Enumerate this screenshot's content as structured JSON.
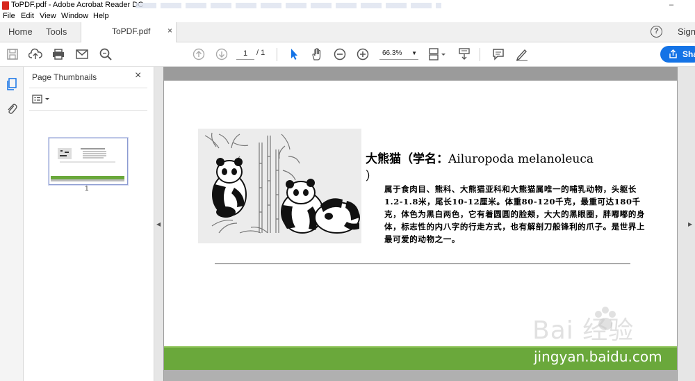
{
  "window": {
    "title": "ToPDF.pdf - Adobe Acrobat Reader DC",
    "minimize": "–"
  },
  "menu": {
    "items": [
      "File",
      "Edit",
      "View",
      "Window",
      "Help"
    ]
  },
  "tabs": {
    "home": "Home",
    "tools": "Tools",
    "document": "ToPDF.pdf",
    "close": "×",
    "signin": "Sign"
  },
  "toolbar": {
    "page_current": "1",
    "page_total": "/ 1",
    "zoom": "66.3%",
    "share_label": "Sha",
    "accent": "#1473e6"
  },
  "sidebar": {
    "heading": "Page Thumbnails",
    "close": "×",
    "thumb_page_number": "1"
  },
  "document": {
    "heading_cn": "大熊猫（学名：",
    "heading_latin": "Ailuropoda melanoleuca",
    "heading_close": "）",
    "paragraph": "属于食肉目、熊科、大熊猫亚科和大熊猫属唯一的哺乳动物，头躯长1.2-1.8米，尾长10-12厘米。体重80-120千克，最重可达180千克，体色为黑白两色，它有着圆圆的脸颊，大大的黑眼圈，胖嘟嘟的身体，标志性的内八字的行走方式，也有解剖刀般锋利的爪子。是世界上最可爱的动物之一。",
    "green": "#6aa83b"
  },
  "watermark": {
    "logo_text": "Bai  经验",
    "url": "jingyan.baidu.com"
  }
}
